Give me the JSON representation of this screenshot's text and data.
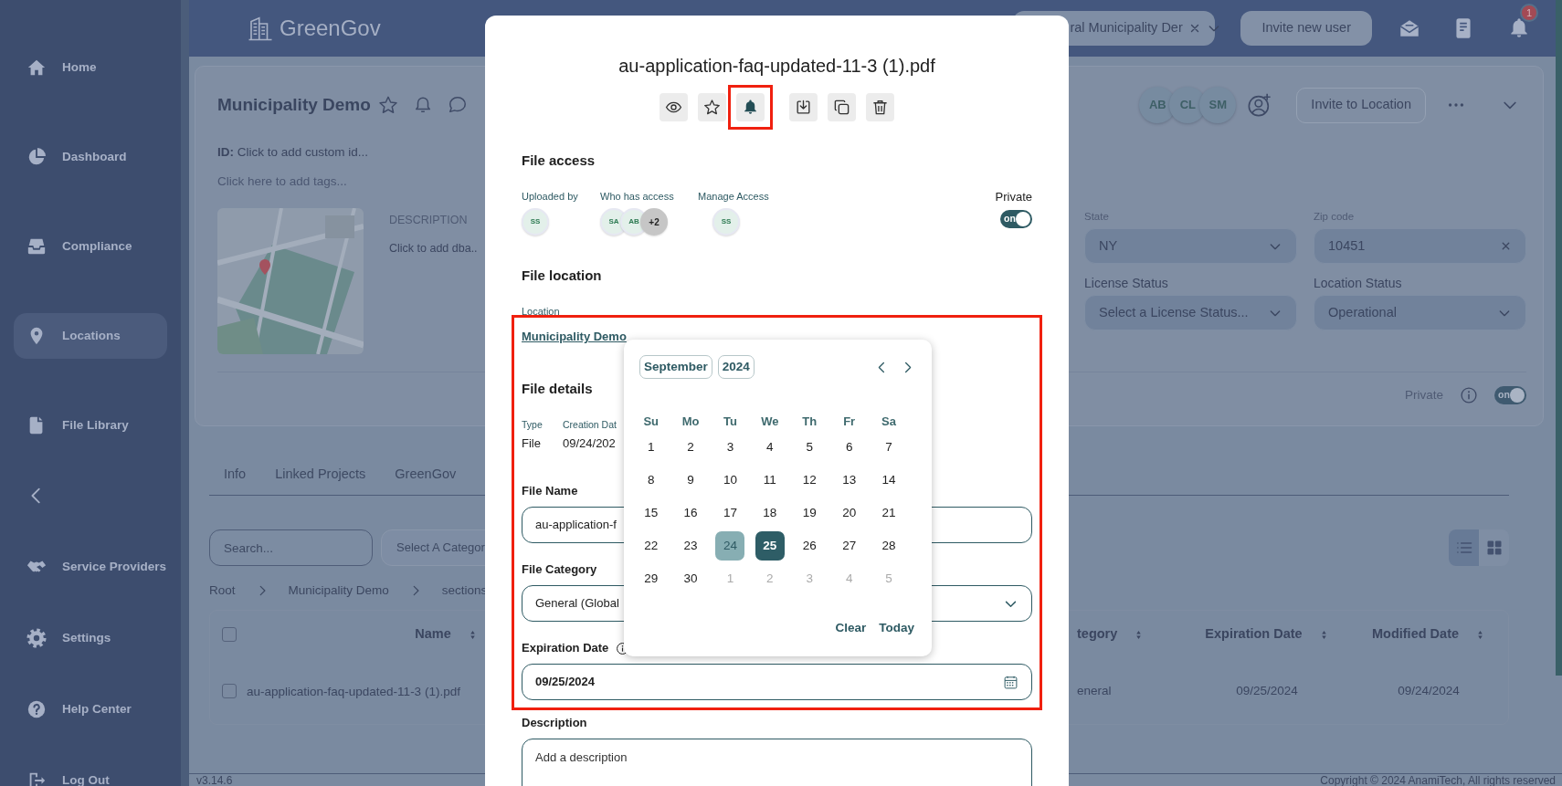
{
  "sidebar": {
    "items": [
      {
        "label": "Home",
        "selected": false
      },
      {
        "label": "Dashboard",
        "selected": false
      },
      {
        "label": "Compliance",
        "selected": false
      },
      {
        "label": "Locations",
        "selected": true
      },
      {
        "label": "File Library",
        "selected": false
      }
    ],
    "lower_items": [
      {
        "label": "Service Providers",
        "selected": false
      },
      {
        "label": "Settings",
        "selected": false
      },
      {
        "label": "Help Center",
        "selected": false
      },
      {
        "label": "Log Out",
        "selected": false
      }
    ]
  },
  "header": {
    "logo": "GreenGov",
    "organization": "ral Municipality Der",
    "invite_button": "Invite new user",
    "notification_count": "1"
  },
  "location_card": {
    "title": "Municipality Demo",
    "id_line": "**ID:** Click to add custom id...",
    "tags_placeholder": "Click here to add tags...",
    "description_label": "DESCRIPTION",
    "description": "Click to add dba..",
    "members": [
      {
        "initials": "AB"
      },
      {
        "initials": "CL"
      },
      {
        "initials": "SM"
      }
    ],
    "invite_button": "Invite to Location",
    "fields": [
      {
        "kind": "select",
        "label": "State",
        "value": "NY"
      },
      {
        "kind": "clearable",
        "label": "Zip code",
        "value": "10451"
      },
      {
        "kind": "select",
        "label": "License Status",
        "placeholder": "Select a License Status..."
      },
      {
        "kind": "select",
        "label": "Location Status",
        "value": "Operational"
      }
    ],
    "private": {
      "label": "Private",
      "on": true,
      "toggle_text": "on"
    }
  },
  "tabs": [
    {
      "label": "Info",
      "selected": false
    },
    {
      "label": "Linked Projects",
      "selected": false
    },
    {
      "label": "GreenGov",
      "selected": false
    }
  ],
  "files": {
    "search_placeholder": "Search...",
    "category_placeholder": "Select A Categor",
    "views": [
      {
        "kind": "list",
        "selected": true
      },
      {
        "kind": "grid",
        "selected": false
      }
    ],
    "breadcrumb": [
      "Root",
      "Municipality Demo",
      "sections"
    ],
    "table": {
      "header_checked": false,
      "columns": [
        "Name",
        "tegory",
        "Expiration Date",
        "Modified Date"
      ],
      "rows": [
        {
          "checked": false,
          "cells": [
            "au-application-faq-updated-11-3 (1).pdf",
            "eneral",
            "09/25/2024",
            "09/24/2024"
          ]
        }
      ]
    }
  },
  "footer": {
    "version": "v3.14.6",
    "copyright": "Copyright © 2024 AnamiTech, All rights reserved"
  },
  "file_modal": {
    "title": "au-application-faq-updated-11-3 (1).pdf",
    "actions": [
      {
        "kind": "view",
        "highlighted": false
      },
      {
        "kind": "favorite",
        "highlighted": false
      },
      {
        "kind": "notify",
        "highlighted": true
      },
      {
        "kind": "download",
        "highlighted": false
      },
      {
        "kind": "duplicate",
        "highlighted": false
      },
      {
        "kind": "delete",
        "highlighted": false
      }
    ],
    "access_heading": "File access",
    "uploaded_by": {
      "label": "Uploaded by",
      "avatars": [
        "SS"
      ]
    },
    "who_has_access": {
      "label": "Who has access",
      "avatars": [
        "SA",
        "AB"
      ],
      "more": "+2"
    },
    "manage_access": {
      "label": "Manage Access",
      "avatars": [
        "SS"
      ]
    },
    "private": {
      "label": "Private",
      "on": true,
      "toggle_text": "on"
    },
    "location_heading": "File location",
    "location_label": "Location",
    "location_link": "Municipality Demo",
    "highlight_region": true,
    "details_heading": "File details",
    "details": [
      {
        "label": "Type",
        "value": "File"
      },
      {
        "label": "Creation Dat",
        "value": "09/24/202"
      }
    ],
    "fields": [
      {
        "kind": "text",
        "label": "File Name",
        "value": "au-application-f"
      },
      {
        "kind": "select",
        "label": "File Category",
        "value": "General (Global"
      },
      {
        "kind": "date",
        "label": "Expiration Date",
        "value": "09/25/2024",
        "info": true
      },
      {
        "kind": "textarea",
        "label": "Description",
        "placeholder": "Add a description"
      }
    ],
    "date_picker": {
      "month": "September",
      "year": "2024",
      "weekdays": [
        "Su",
        "Mo",
        "Tu",
        "We",
        "Th",
        "Fr",
        "Sa"
      ],
      "days": [
        {
          "label": "1",
          "muted": false,
          "today": false,
          "selected": false
        },
        {
          "label": "2",
          "muted": false,
          "today": false,
          "selected": false
        },
        {
          "label": "3",
          "muted": false,
          "today": false,
          "selected": false
        },
        {
          "label": "4",
          "muted": false,
          "today": false,
          "selected": false
        },
        {
          "label": "5",
          "muted": false,
          "today": false,
          "selected": false
        },
        {
          "label": "6",
          "muted": false,
          "today": false,
          "selected": false
        },
        {
          "label": "7",
          "muted": false,
          "today": false,
          "selected": false
        },
        {
          "label": "8",
          "muted": false,
          "today": false,
          "selected": false
        },
        {
          "label": "9",
          "muted": false,
          "today": false,
          "selected": false
        },
        {
          "label": "10",
          "muted": false,
          "today": false,
          "selected": false
        },
        {
          "label": "11",
          "muted": false,
          "today": false,
          "selected": false
        },
        {
          "label": "12",
          "muted": false,
          "today": false,
          "selected": false
        },
        {
          "label": "13",
          "muted": false,
          "today": false,
          "selected": false
        },
        {
          "label": "14",
          "muted": false,
          "today": false,
          "selected": false
        },
        {
          "label": "15",
          "muted": false,
          "today": false,
          "selected": false
        },
        {
          "label": "16",
          "muted": false,
          "today": false,
          "selected": false
        },
        {
          "label": "17",
          "muted": false,
          "today": false,
          "selected": false
        },
        {
          "label": "18",
          "muted": false,
          "today": false,
          "selected": false
        },
        {
          "label": "19",
          "muted": false,
          "today": false,
          "selected": false
        },
        {
          "label": "20",
          "muted": false,
          "today": false,
          "selected": false
        },
        {
          "label": "21",
          "muted": false,
          "today": false,
          "selected": false
        },
        {
          "label": "22",
          "muted": false,
          "today": false,
          "selected": false
        },
        {
          "label": "23",
          "muted": false,
          "today": false,
          "selected": false
        },
        {
          "label": "24",
          "muted": false,
          "today": true,
          "selected": false
        },
        {
          "label": "25",
          "muted": false,
          "today": false,
          "selected": true
        },
        {
          "label": "26",
          "muted": false,
          "today": false,
          "selected": false
        },
        {
          "label": "27",
          "muted": false,
          "today": false,
          "selected": false
        },
        {
          "label": "28",
          "muted": false,
          "today": false,
          "selected": false
        },
        {
          "label": "29",
          "muted": false,
          "today": false,
          "selected": false
        },
        {
          "label": "30",
          "muted": false,
          "today": false,
          "selected": false
        },
        {
          "label": "1",
          "muted": true,
          "today": false,
          "selected": false
        },
        {
          "label": "2",
          "muted": true,
          "today": false,
          "selected": false
        },
        {
          "label": "3",
          "muted": true,
          "today": false,
          "selected": false
        },
        {
          "label": "4",
          "muted": true,
          "today": false,
          "selected": false
        },
        {
          "label": "5",
          "muted": true,
          "today": false,
          "selected": false
        }
      ],
      "clear_button": "Clear",
      "today_button": "Today"
    }
  }
}
